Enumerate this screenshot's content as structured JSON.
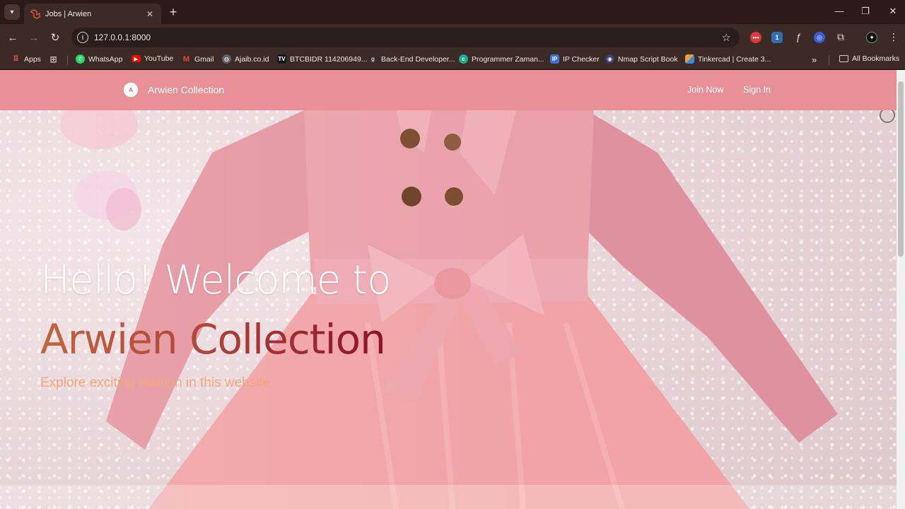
{
  "browser": {
    "tab": {
      "title": "Jobs | Arwien",
      "close": "✕"
    },
    "new_tab": "+",
    "window_controls": {
      "minimize": "—",
      "maximize": "❐",
      "close": "✕"
    },
    "url": "127.0.0.1:8000",
    "bookmarks": [
      {
        "label": "Apps",
        "icon": "apps-grid-icon",
        "color": "#e06055"
      },
      {
        "label": "WhatsApp",
        "icon": "whatsapp-icon",
        "color": "#25d366"
      },
      {
        "label": "YouTube",
        "icon": "youtube-icon",
        "color": "#ff0000"
      },
      {
        "label": "Gmail",
        "icon": "gmail-icon",
        "color": "#ea4335"
      },
      {
        "label": "Ajaib.co.id",
        "icon": "globe-icon",
        "color": "#5f6368"
      },
      {
        "label": "BTCBIDR 114206949...",
        "icon": "tradingview-icon",
        "color": "#131722"
      },
      {
        "label": "Back-End Developer...",
        "icon": "g-icon",
        "color": "#4a5a8a"
      },
      {
        "label": "Programmer Zaman...",
        "icon": "programmer-icon",
        "color": "#1faa89"
      },
      {
        "label": "IP Checker",
        "icon": "ip-icon",
        "color": "#3f6fd1"
      },
      {
        "label": "Nmap Script Book",
        "icon": "nmap-eye-icon",
        "color": "#3a3f7a"
      },
      {
        "label": "Tinkercad | Create 3...",
        "icon": "tinkercad-icon",
        "color": "#e8a33c"
      }
    ],
    "overflow": "»",
    "all_bookmarks": "All Bookmarks"
  },
  "site": {
    "brand": {
      "name": "Arwien Collection",
      "logo_letter": "A"
    },
    "nav": {
      "join": "Join Now",
      "signin": "Sign In"
    },
    "hero": {
      "line1": "Hello! Welcome to",
      "line2": "Arwien Collection",
      "subtitle": "Explore exciting fashion in this website"
    },
    "colors": {
      "navbar": "#e88f98",
      "dress": "#e9a0a6",
      "subtitle": "#f2a87b",
      "gradient_start": "#c0673d",
      "gradient_end": "#8b1228"
    }
  }
}
